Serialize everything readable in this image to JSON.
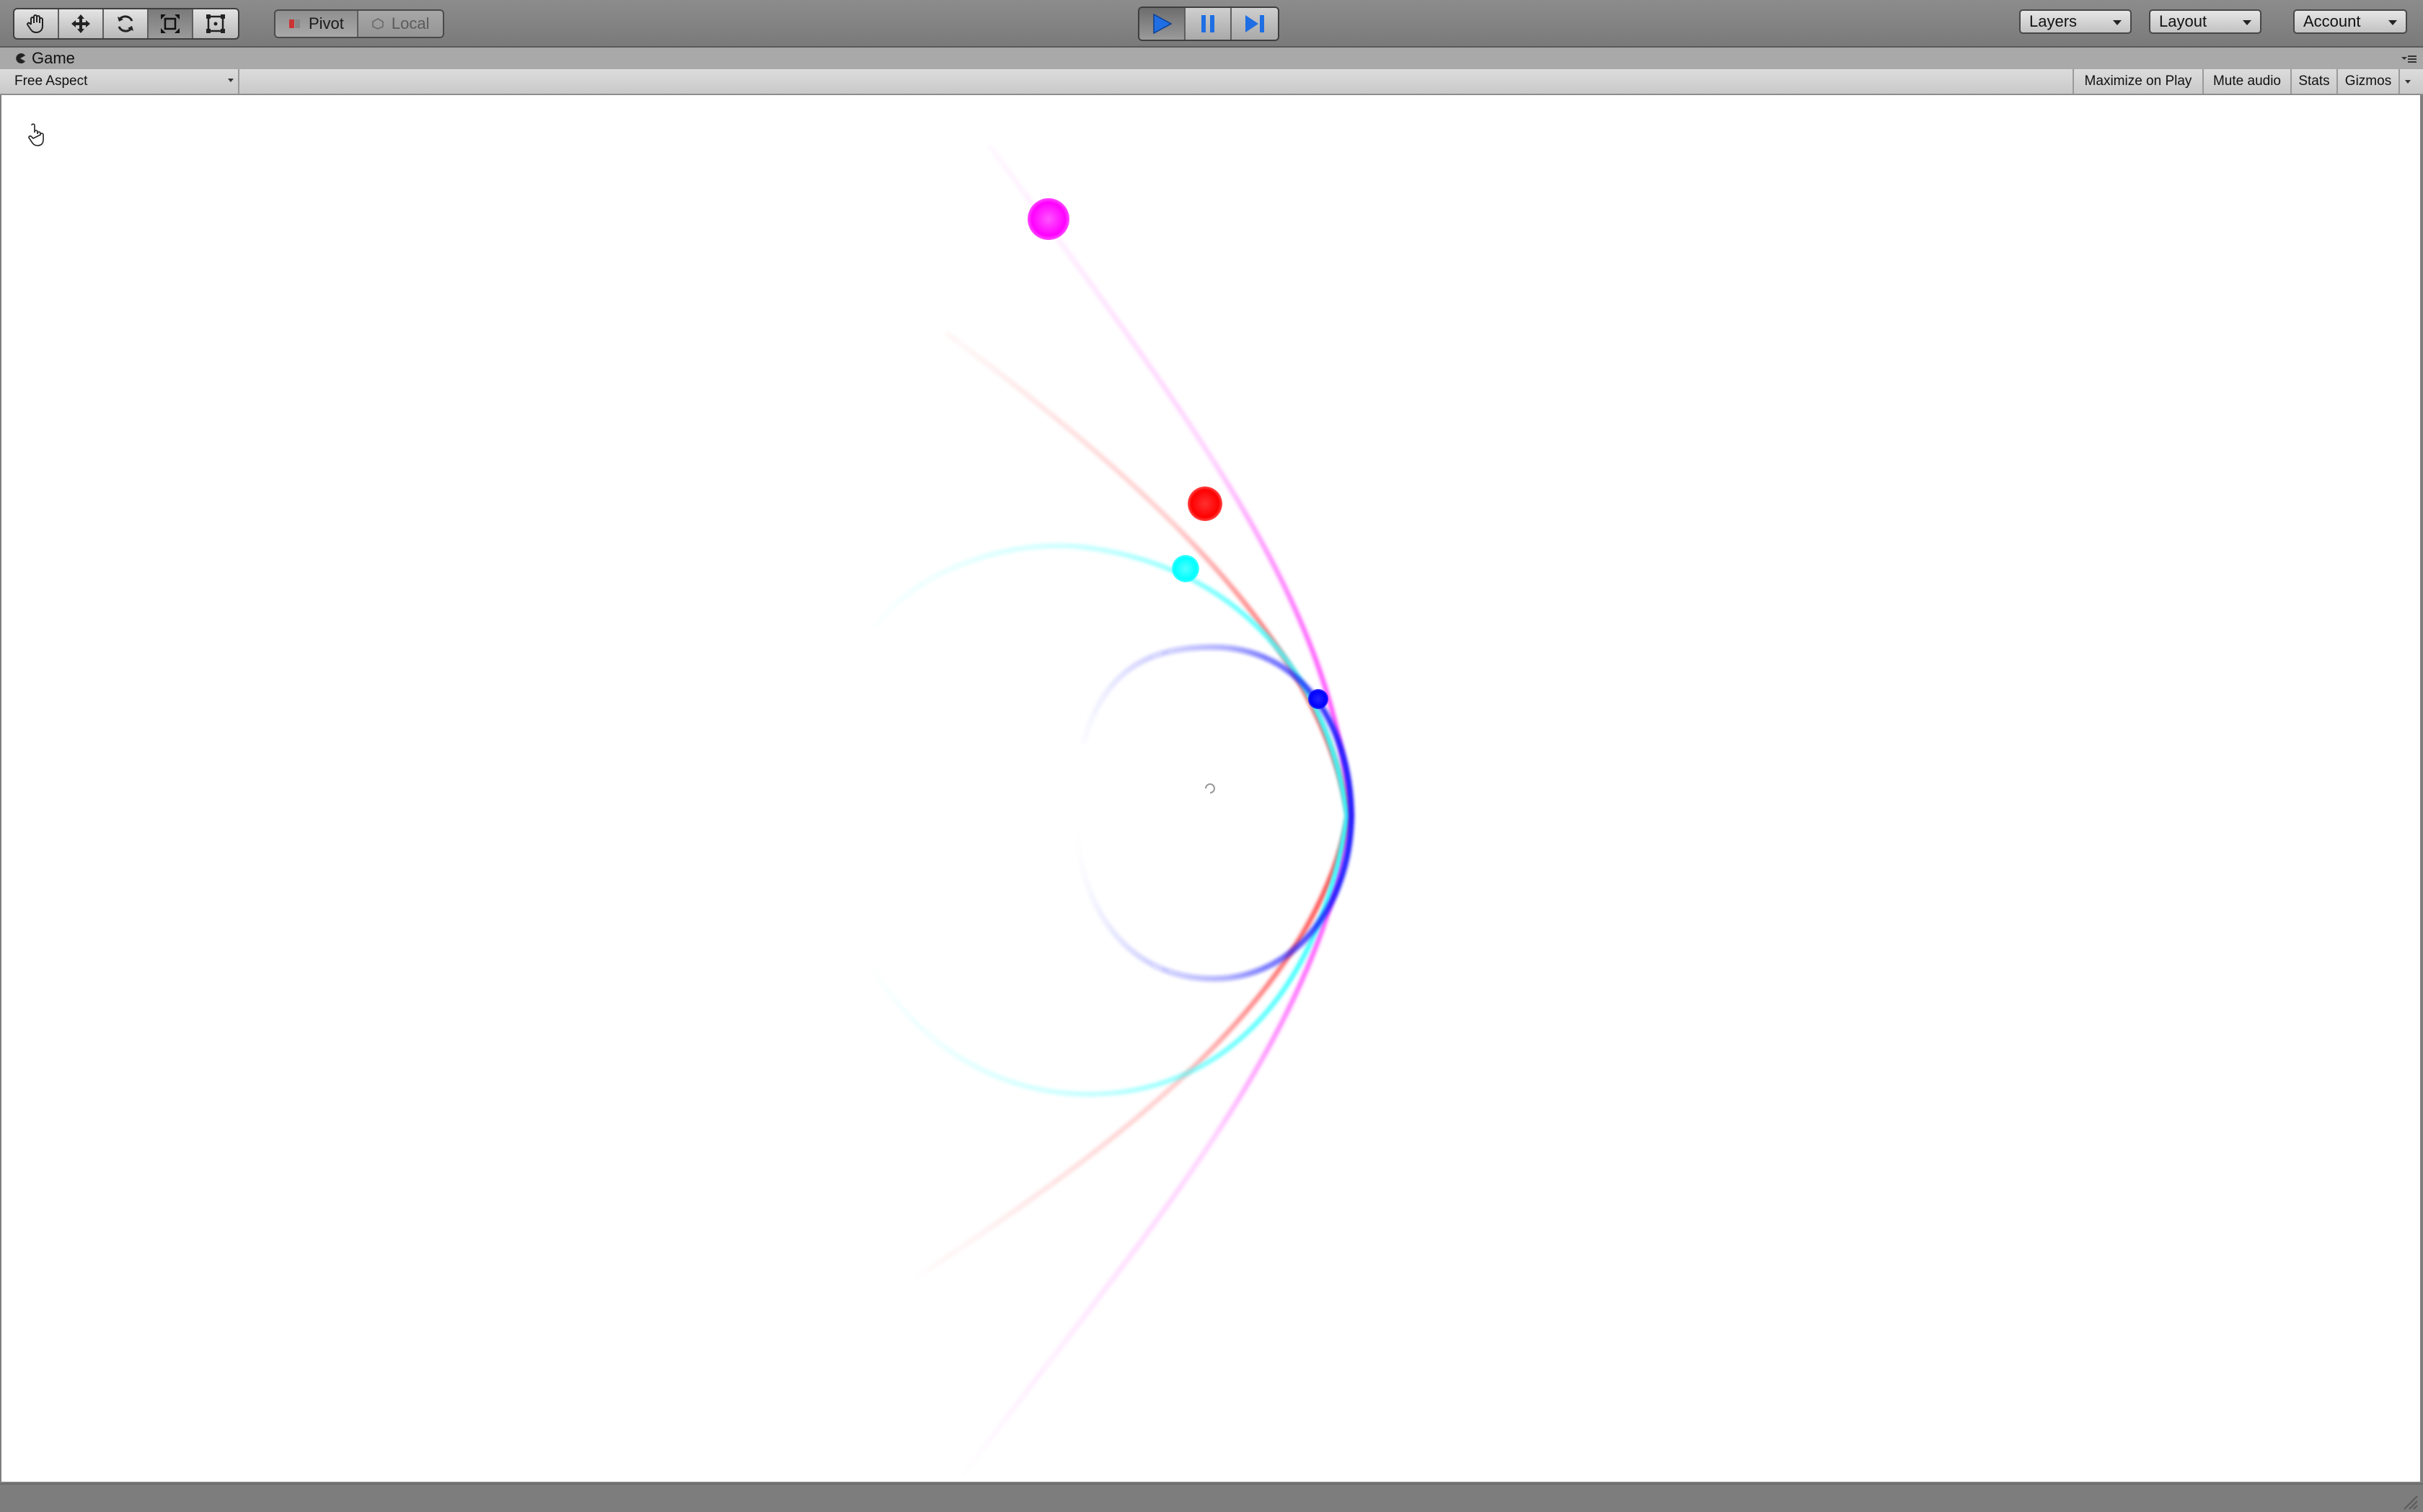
{
  "toolbar": {
    "transform_tools": [
      {
        "name": "hand-tool",
        "icon": "hand-icon",
        "active": false
      },
      {
        "name": "move-tool",
        "icon": "move-arrows-icon",
        "active": false
      },
      {
        "name": "rotate-tool",
        "icon": "rotate-icon",
        "active": false
      },
      {
        "name": "scale-tool",
        "icon": "scale-icon",
        "active": true
      },
      {
        "name": "rect-tool",
        "icon": "rect-transform-icon",
        "active": false
      }
    ],
    "pivot_label": "Pivot",
    "local_label": "Local",
    "playback": {
      "play_icon": "play-icon",
      "pause_icon": "pause-icon",
      "step_icon": "step-icon",
      "playing": true,
      "accent": "#1a63d6"
    },
    "layers_label": "Layers",
    "layout_label": "Layout",
    "account_label": "Account"
  },
  "game_window": {
    "tab_title": "Game",
    "aspect_label": "Free Aspect",
    "maximize_label": "Maximize on Play",
    "mute_label": "Mute audio",
    "stats_label": "Stats",
    "gizmos_label": "Gizmos"
  },
  "scene": {
    "background": "#ffffff",
    "cursor_icon": "pointer-hand-icon",
    "bodies": [
      {
        "name": "magenta-orb",
        "color": "#ff00ff"
      },
      {
        "name": "red-orb",
        "color": "#ff0000"
      },
      {
        "name": "cyan-orb",
        "color": "#00ffff"
      },
      {
        "name": "blue-orb",
        "color": "#0000ff"
      }
    ],
    "trail_colors": {
      "blue": "#1a1aff",
      "cyan": "#33ffff",
      "red": "#ff3d3d",
      "magenta": "#ff33ff"
    }
  }
}
